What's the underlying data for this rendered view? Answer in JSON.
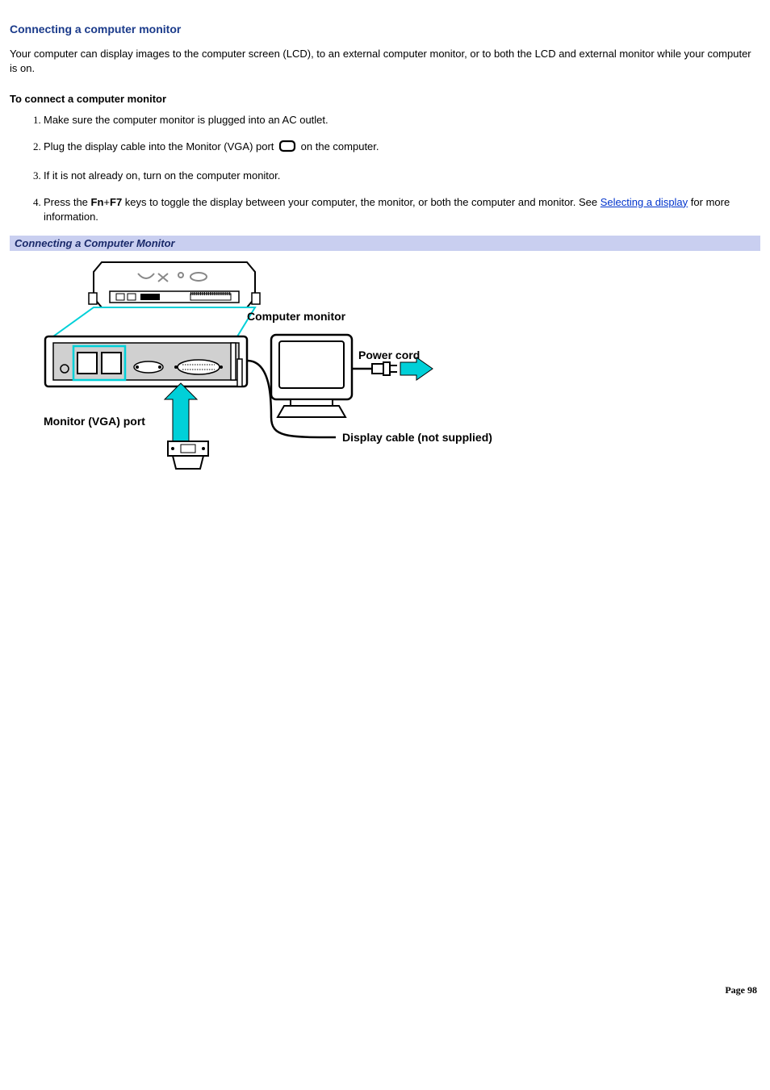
{
  "heading": "Connecting a computer monitor",
  "intro": "Your computer can display images to the computer screen (LCD), to an external computer monitor, or to both the LCD and external monitor while your computer is on.",
  "subheading": "To connect a computer monitor",
  "steps": {
    "s1": "Make sure the computer monitor is plugged into an AC outlet.",
    "s2_a": "Plug the display cable into the Monitor (VGA) port ",
    "s2_b": " on the computer.",
    "s3": "If it is not already on, turn on the computer monitor.",
    "s4_a": "Press the ",
    "s4_key1": "Fn",
    "s4_plus": "+",
    "s4_key2": "F7",
    "s4_b": " keys to toggle the display between your computer, the monitor, or both the computer and monitor. See ",
    "s4_link": "Selecting a display",
    "s4_c": " for more information."
  },
  "figure_caption": "Connecting a Computer Monitor",
  "diagram_labels": {
    "computer_monitor": "Computer monitor",
    "power_cord": "Power cord",
    "vga_port": "Monitor (VGA) port",
    "display_cable": "Display cable (not supplied)"
  },
  "footer": "Page 98"
}
